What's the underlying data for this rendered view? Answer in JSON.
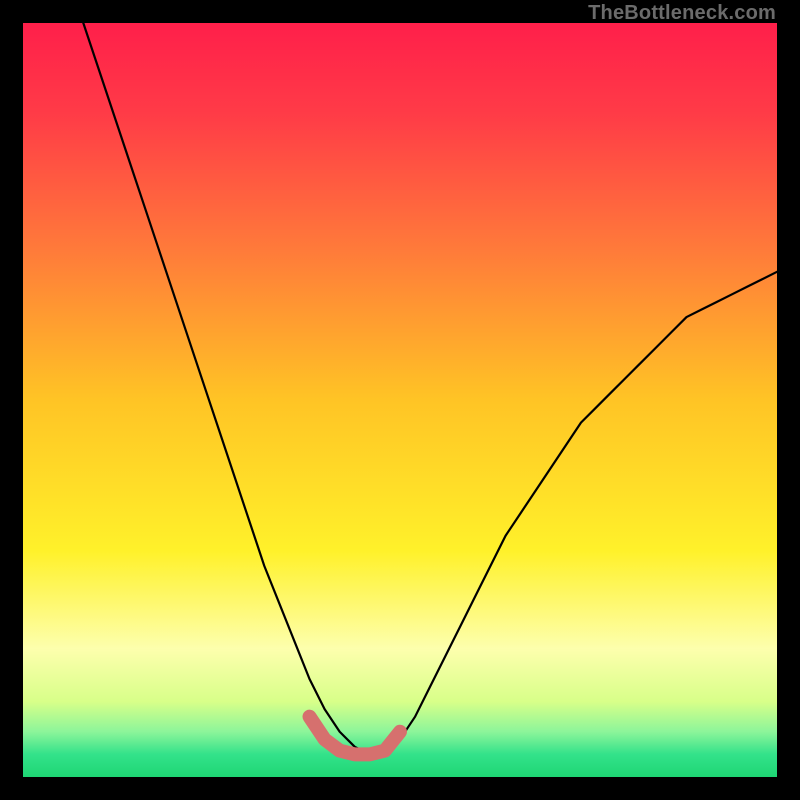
{
  "watermark": "TheBottleneck.com",
  "chart_data": {
    "type": "line",
    "title": "",
    "xlabel": "",
    "ylabel": "",
    "xlim": [
      0,
      100
    ],
    "ylim": [
      0,
      100
    ],
    "description": "Bottleneck percentage curve over a red-to-green vertical gradient. The black curve drops steeply from top-left, reaches a flat minimum around x≈40–48 at y≈3, then rises with decreasing slope toward the right edge reaching y≈67 at x=100. A short salmon-colored thick overlay marks the flat-bottom optimum region.",
    "series": [
      {
        "name": "bottleneck-curve",
        "color": "#000000",
        "x": [
          8,
          10,
          12,
          14,
          16,
          18,
          20,
          22,
          24,
          26,
          28,
          30,
          32,
          34,
          36,
          38,
          40,
          42,
          44,
          46,
          48,
          50,
          52,
          54,
          56,
          58,
          60,
          62,
          64,
          66,
          68,
          70,
          72,
          74,
          76,
          78,
          80,
          82,
          84,
          86,
          88,
          90,
          92,
          94,
          96,
          98,
          100
        ],
        "y": [
          100,
          94,
          88,
          82,
          76,
          70,
          64,
          58,
          52,
          46,
          40,
          34,
          28,
          23,
          18,
          13,
          9,
          6,
          4,
          3,
          3,
          5,
          8,
          12,
          16,
          20,
          24,
          28,
          32,
          35,
          38,
          41,
          44,
          47,
          49,
          51,
          53,
          55,
          57,
          59,
          61,
          62,
          63,
          64,
          65,
          66,
          67
        ]
      },
      {
        "name": "optimum-marker",
        "color": "#d6706e",
        "x": [
          38,
          40,
          42,
          44,
          46,
          48,
          50
        ],
        "y": [
          8,
          5,
          3.5,
          3,
          3,
          3.5,
          6
        ]
      }
    ],
    "background_gradient_stops": [
      {
        "pos": 0.0,
        "color": "#ff1f4a"
      },
      {
        "pos": 0.12,
        "color": "#ff3b47"
      },
      {
        "pos": 0.3,
        "color": "#ff7a3a"
      },
      {
        "pos": 0.5,
        "color": "#ffc425"
      },
      {
        "pos": 0.7,
        "color": "#fff12a"
      },
      {
        "pos": 0.83,
        "color": "#fdffad"
      },
      {
        "pos": 0.9,
        "color": "#d8ff89"
      },
      {
        "pos": 0.94,
        "color": "#8cf59a"
      },
      {
        "pos": 0.97,
        "color": "#33e28a"
      },
      {
        "pos": 1.0,
        "color": "#1ed674"
      }
    ]
  }
}
